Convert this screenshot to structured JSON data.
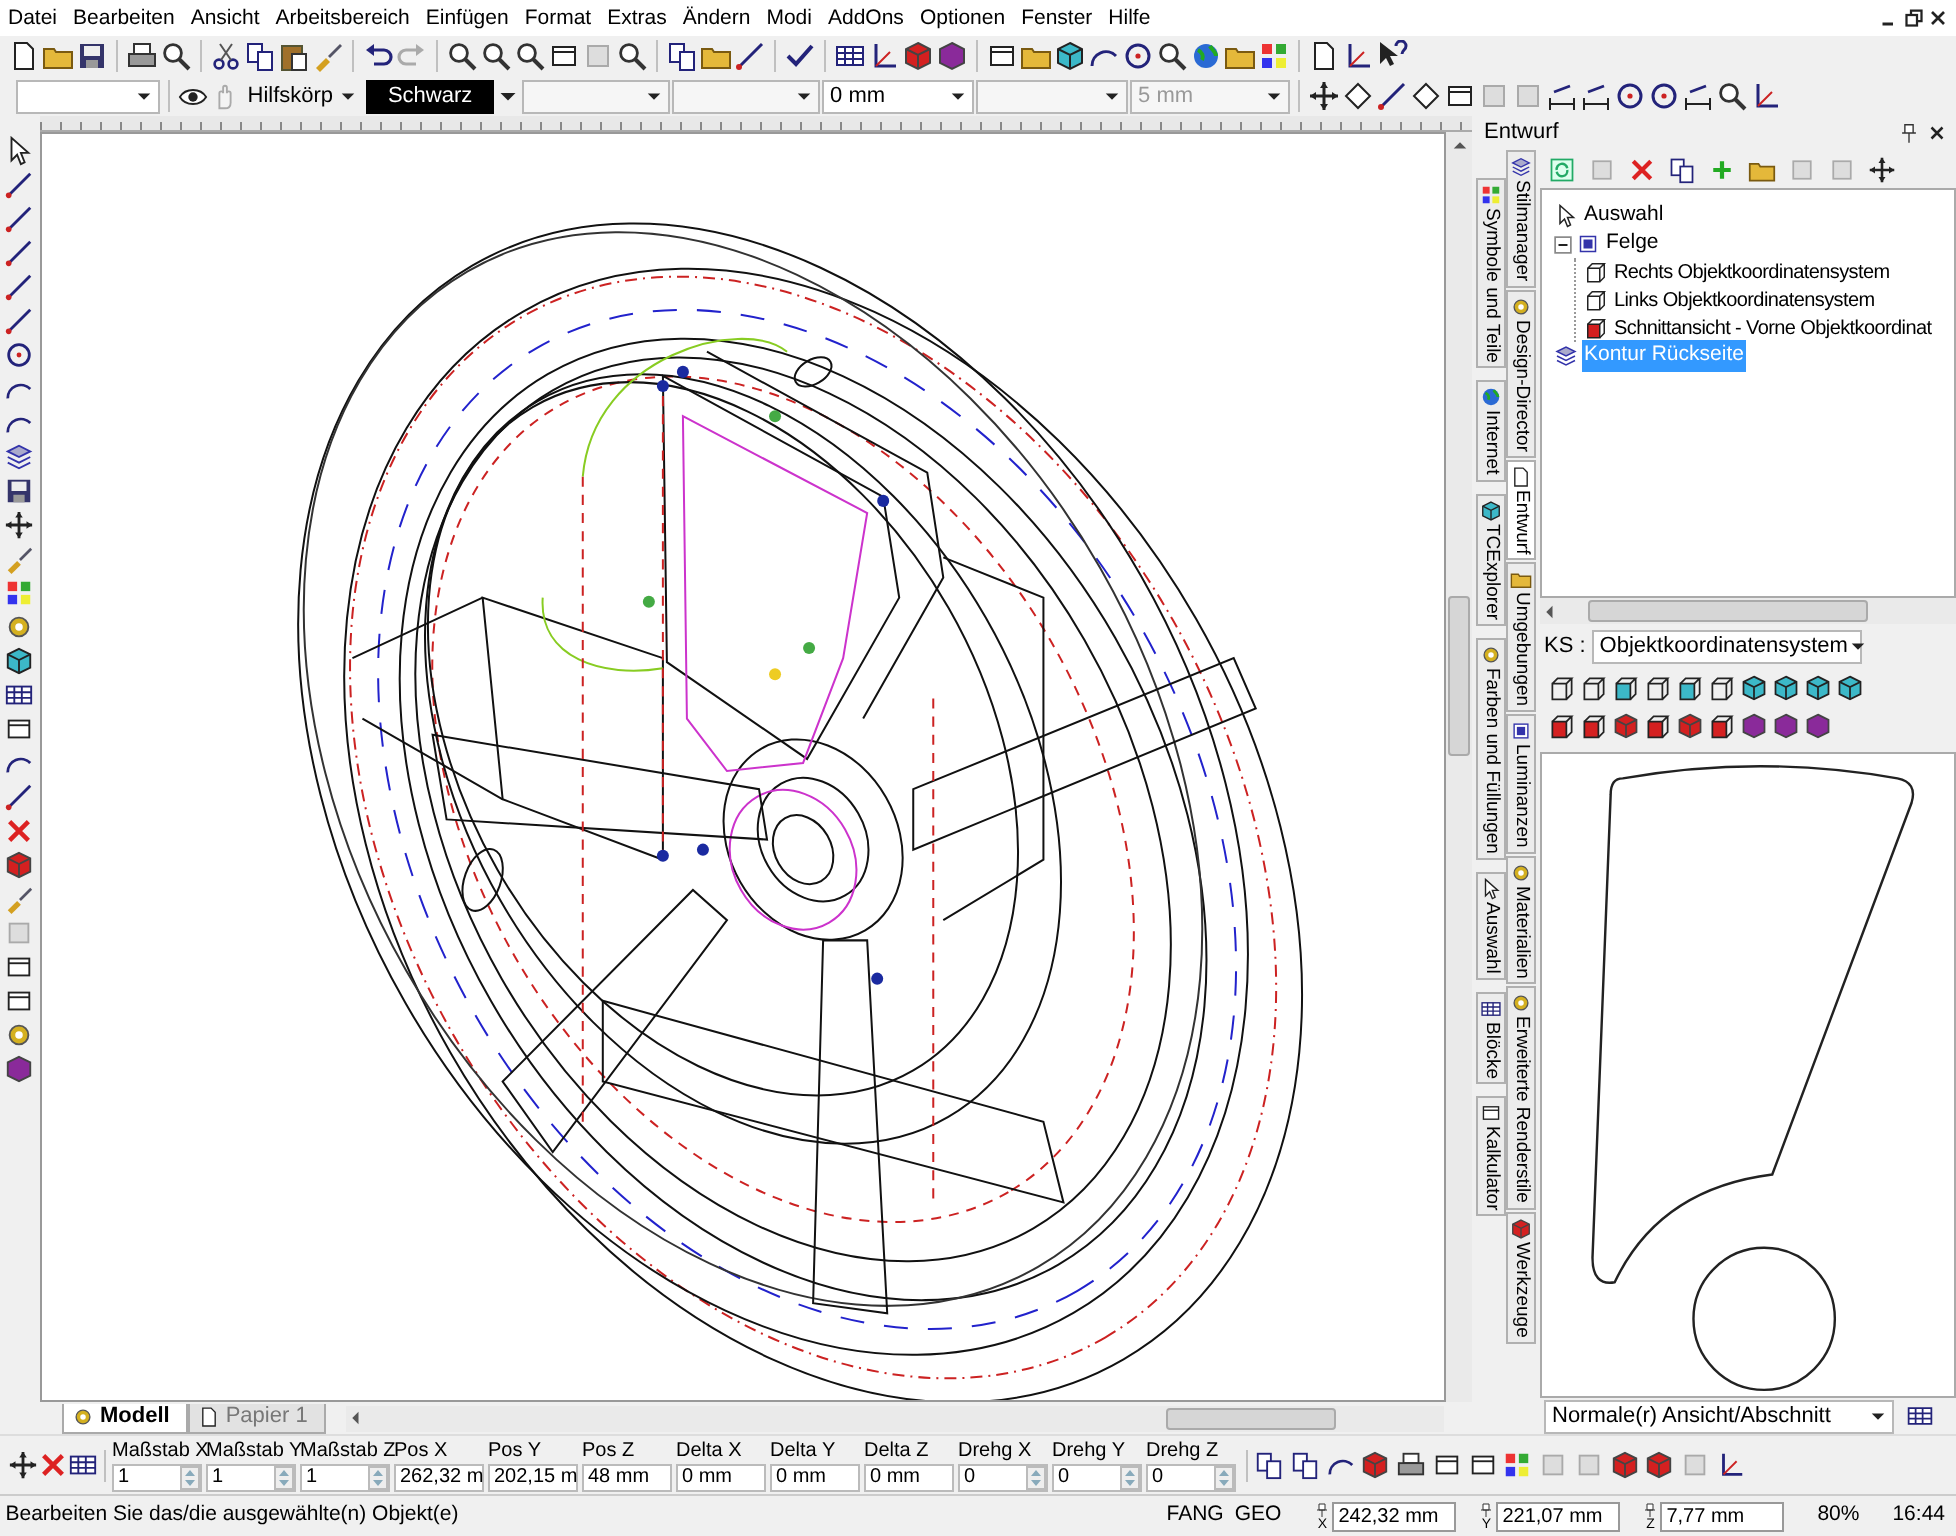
{
  "menu": [
    "Datei",
    "Bearbeiten",
    "Ansicht",
    "Arbeitsbereich",
    "Einfügen",
    "Format",
    "Extras",
    "Ändern",
    "Modi",
    "AddOns",
    "Optionen",
    "Fenster",
    "Hilfe"
  ],
  "format_bar": {
    "layer": "Hilfskörp",
    "pen": "Schwarz",
    "line_width": "0 mm",
    "spacing": {
      "value": "5 mm",
      "disabled": true
    }
  },
  "document_tabs": [
    {
      "label": "Modell",
      "selected": true
    },
    {
      "label": "Papier 1",
      "selected": false
    }
  ],
  "dock": {
    "title": "Entwurf",
    "tabs_outer": [
      {
        "label": "Symbole und Teile",
        "selected": false
      },
      {
        "label": "Internet",
        "selected": false
      },
      {
        "label": "TCExplorer",
        "selected": false
      },
      {
        "label": "Farben und Füllungen",
        "selected": false
      },
      {
        "label": "Auswahl",
        "selected": false
      },
      {
        "label": "Blöcke",
        "selected": false
      },
      {
        "label": "Kalkulator",
        "selected": false
      }
    ],
    "tabs_inner": [
      {
        "label": "Stilmanager",
        "selected": false
      },
      {
        "label": "Design-Director",
        "selected": false
      },
      {
        "label": "Entwurf",
        "selected": true
      },
      {
        "label": "Umgebungen",
        "selected": false
      },
      {
        "label": "Luminanzen",
        "selected": false
      },
      {
        "label": "Materialien",
        "selected": false
      },
      {
        "label": "Erweiterte Renderstile",
        "selected": false
      },
      {
        "label": "Werkzeuge",
        "selected": false
      }
    ],
    "tree": [
      {
        "label": "Auswahl",
        "kind": "pointer",
        "selected": false
      },
      {
        "label": "Felge",
        "kind": "group",
        "selected": false,
        "expanded": true,
        "children": [
          {
            "label": "Rechts Objektkoordinatensystem",
            "kind": "frame",
            "selected": false
          },
          {
            "label": "Links Objektkoordinatensystem",
            "kind": "frame",
            "selected": false
          },
          {
            "label": "Schnittansicht - Vorne Objektkoordinat",
            "kind": "section",
            "selected": false
          }
        ]
      },
      {
        "label": "Kontur Rückseite",
        "kind": "contour",
        "selected": true
      }
    ],
    "ks": {
      "label": "KS :",
      "value": "Objektkoordinatensystem"
    },
    "view_select": "Normale(r) Ansicht/Abschnitt"
  },
  "properties": [
    {
      "label": "Maßstab X",
      "value": "1",
      "kind": "spin"
    },
    {
      "label": "Maßstab Y",
      "value": "1",
      "kind": "spin"
    },
    {
      "label": "Maßstab Z",
      "value": "1",
      "kind": "spin"
    },
    {
      "label": "Pos X",
      "value": "262,32 m",
      "kind": "text"
    },
    {
      "label": "Pos Y",
      "value": "202,15 m",
      "kind": "text"
    },
    {
      "label": "Pos Z",
      "value": "48 mm",
      "kind": "text"
    },
    {
      "label": "Delta X",
      "value": "0 mm",
      "kind": "text"
    },
    {
      "label": "Delta Y",
      "value": "0 mm",
      "kind": "text"
    },
    {
      "label": "Delta Z",
      "value": "0 mm",
      "kind": "text"
    },
    {
      "label": "Drehg X",
      "value": "0",
      "kind": "spin"
    },
    {
      "label": "Drehg Y",
      "value": "0",
      "kind": "spin"
    },
    {
      "label": "Drehg Z",
      "value": "0",
      "kind": "spin"
    }
  ],
  "status_bar": {
    "message": "Bearbeiten Sie das/die ausgewählte(n) Objekt(e)",
    "indicators": [
      "FANG",
      "GEO"
    ],
    "coordinates": [
      {
        "axis": "X",
        "value": "242,32 mm"
      },
      {
        "axis": "Y",
        "value": "221,07 mm"
      },
      {
        "axis": "Z",
        "value": "7,77 mm"
      }
    ],
    "zoom": "80%",
    "time": "16:44"
  }
}
